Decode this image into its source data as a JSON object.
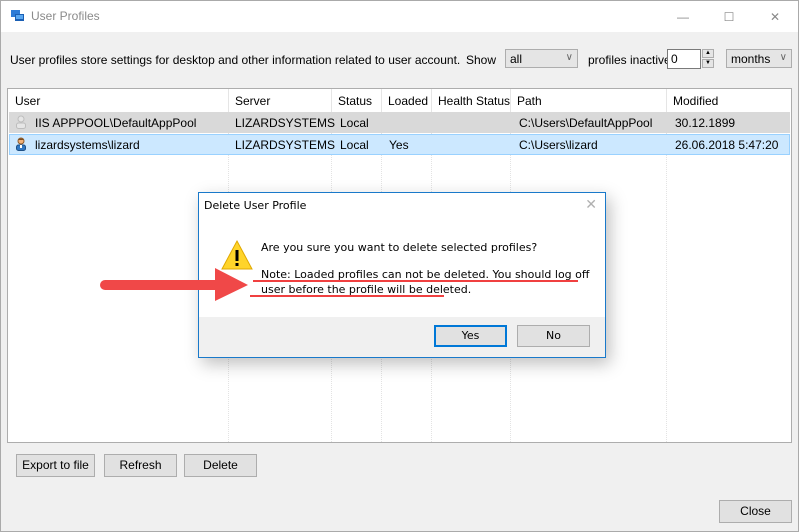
{
  "window": {
    "title": "User Profiles",
    "icon": "user-profiles-app-icon",
    "controls": {
      "minimize": "—",
      "maximize": "☐",
      "close": "✕"
    }
  },
  "toolbar": {
    "description": "User profiles store settings for desktop and other information related to user account.",
    "show_label": "Show",
    "show_value": "all",
    "inactive_label": "profiles inactive",
    "inactive_value": "0",
    "unit_value": "months"
  },
  "table": {
    "columns": [
      "User",
      "Server",
      "Status",
      "Loaded",
      "Health Status",
      "Path",
      "Modified"
    ],
    "rows": [
      {
        "user": "IIS APPPOOL\\DefaultAppPool",
        "server": "LIZARDSYSTEMS",
        "status": "Local",
        "loaded": "",
        "health": "",
        "path": "C:\\Users\\DefaultAppPool",
        "modified": "30.12.1899",
        "icon": "user-inactive-icon",
        "state": "gray"
      },
      {
        "user": "lizardsystems\\lizard",
        "server": "LIZARDSYSTEMS",
        "status": "Local",
        "loaded": "Yes",
        "health": "",
        "path": "C:\\Users\\lizard",
        "modified": "26.06.2018 5:47:20",
        "icon": "user-active-icon",
        "state": "selected"
      }
    ]
  },
  "buttons": {
    "export": "Export to file",
    "refresh": "Refresh",
    "delete": "Delete",
    "close": "Close"
  },
  "dialog": {
    "title": "Delete User Profile",
    "close": "✕",
    "question": "Are you sure you want to delete selected profiles?",
    "note": "Note: Loaded profiles can not be deleted. You should log off user before the profile will be deleted.",
    "yes": "Yes",
    "no": "No"
  },
  "colors": {
    "accent": "#1979ca",
    "selection": "#cce8ff",
    "annotation_red": "#f04040"
  }
}
